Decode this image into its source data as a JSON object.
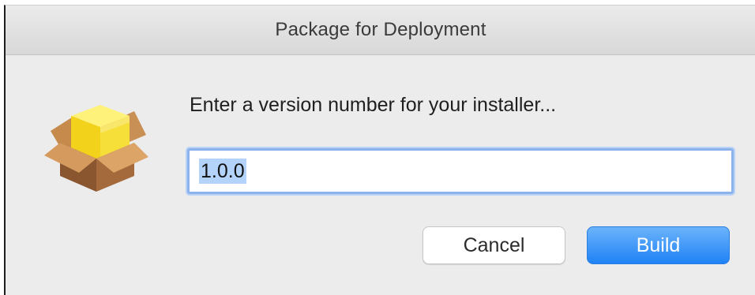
{
  "window": {
    "title": "Package for Deployment"
  },
  "dialog": {
    "icon": "package-icon",
    "prompt": "Enter a version number for your installer...",
    "version_input": {
      "value": "1.0.0"
    },
    "buttons": {
      "cancel_label": "Cancel",
      "build_label": "Build"
    }
  },
  "colors": {
    "accent": "#2f86f6",
    "window_bg": "#ececec"
  }
}
